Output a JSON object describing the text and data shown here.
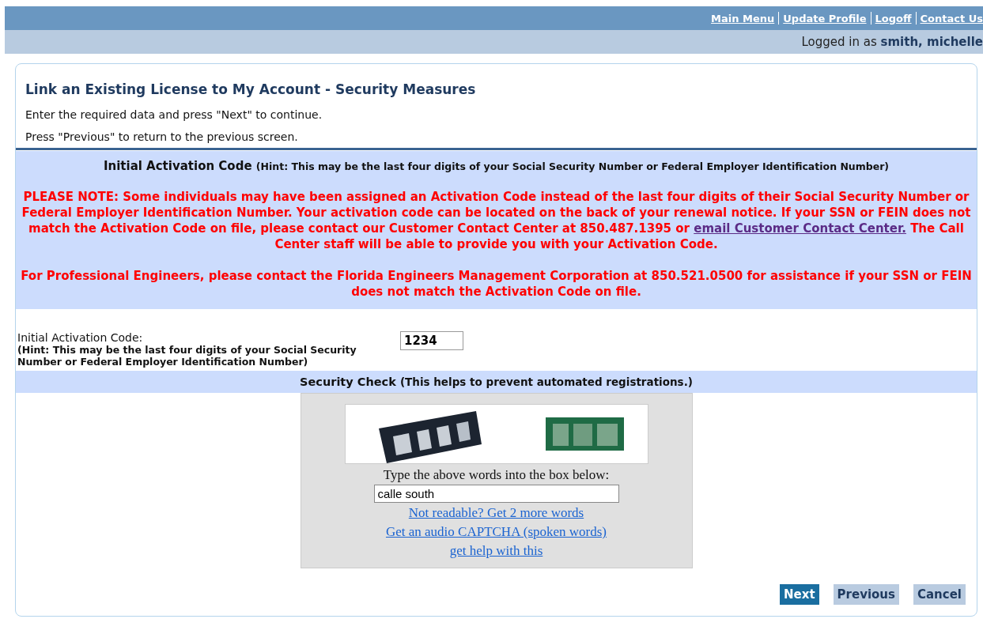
{
  "top_nav": {
    "links": [
      "Main Menu",
      "Update Profile",
      "Logoff",
      "Contact Us"
    ]
  },
  "user_bar": {
    "prefix": "Logged in as",
    "user": "smith, michelle"
  },
  "header": {
    "title": "Link an Existing License to My Account - Security Measures",
    "instructions": [
      "Enter the required data and press \"Next\" to continue.",
      "Press \"Previous\" to return to the previous screen."
    ]
  },
  "notice": {
    "heading": "Initial Activation Code",
    "hint": "(Hint: This may be the last four digits of your Social Security Number or Federal Employer Identification Number)",
    "note_before": "PLEASE NOTE: Some individuals may have been assigned an Activation Code instead of the last four digits of their Social Security Number or Federal Employer Identification Number. Your activation code can be located on the back of your renewal notice. If your SSN or FEIN does not match the Activation Code on file, please contact our Customer Contact Center at 850.487.1395 or",
    "note_link": "email Customer Contact Center.",
    "note_after": "The Call Center staff will be able to provide you with your Activation Code.",
    "engineers": "For Professional Engineers, please contact the Florida Engineers Management Corporation at 850.521.0500 for assistance if your SSN or FEIN does not match the Activation Code on file."
  },
  "activation_field": {
    "label": "Initial Activation Code:",
    "hint": "(Hint: This may be the last four digits of your Social Security Number or Federal Employer Identification Number)",
    "value": "1234"
  },
  "security_check": {
    "heading": "Security Check",
    "hint": "(This helps to prevent automated registrations.)"
  },
  "captcha": {
    "prompt": "Type the above words into the box below:",
    "value": "calle south",
    "links": [
      "Not readable? Get 2 more words",
      "Get an audio CAPTCHA (spoken words)",
      "get help with this"
    ]
  },
  "buttons": [
    {
      "label": "Next",
      "selected": true
    },
    {
      "label": "Previous",
      "selected": false
    },
    {
      "label": "Cancel",
      "selected": false
    }
  ]
}
